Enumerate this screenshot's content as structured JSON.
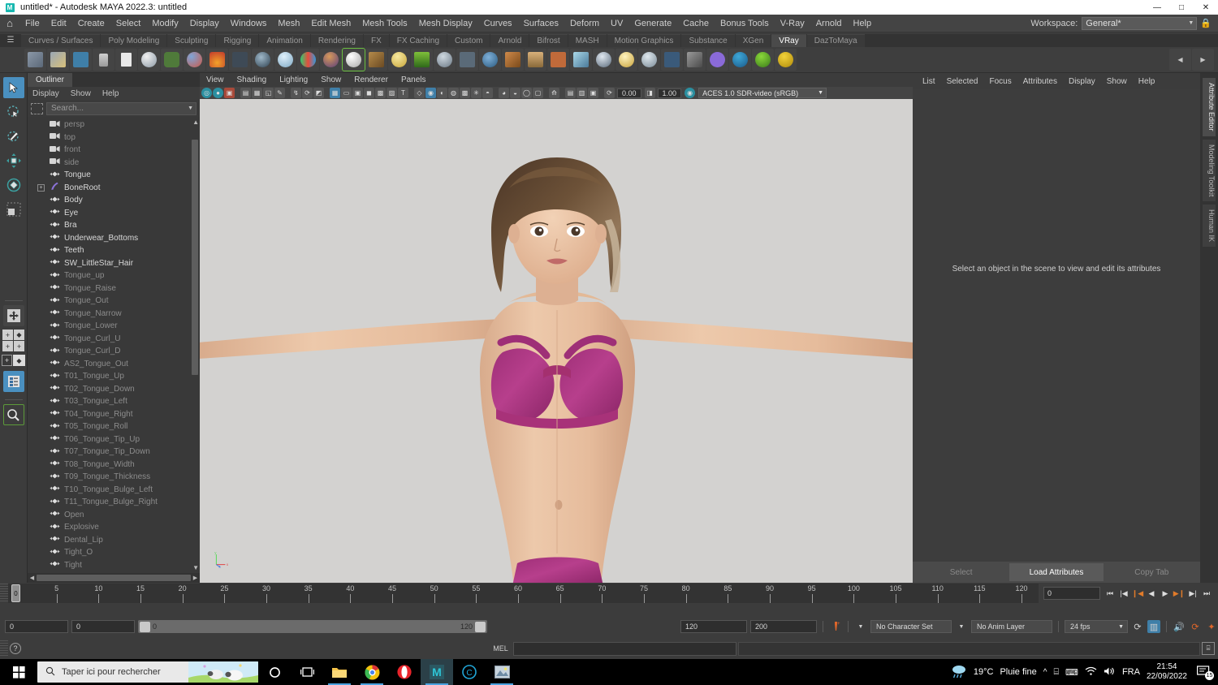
{
  "window": {
    "title": "untitled* - Autodesk MAYA 2022.3: untitled",
    "app_badge": "M",
    "minimize": "—",
    "maximize": "□",
    "close": "✕"
  },
  "main_menu": {
    "home_icon": "⌂",
    "items": [
      "File",
      "Edit",
      "Create",
      "Select",
      "Modify",
      "Display",
      "Windows",
      "Mesh",
      "Edit Mesh",
      "Mesh Tools",
      "Mesh Display",
      "Curves",
      "Surfaces",
      "Deform",
      "UV",
      "Generate",
      "Cache",
      "Bonus Tools",
      "V-Ray",
      "Arnold",
      "Help"
    ],
    "workspace_label": "Workspace:",
    "workspace_value": "General*",
    "lock_icon": "🔒"
  },
  "shelf": {
    "menu_icon": "☰",
    "tabs": [
      "Curves / Surfaces",
      "Poly Modeling",
      "Sculpting",
      "Rigging",
      "Animation",
      "Rendering",
      "FX",
      "FX Caching",
      "Custom",
      "Arnold",
      "Bifrost",
      "MASH",
      "Motion Graphics",
      "Substance",
      "XGen",
      "VRay",
      "DazToMaya"
    ],
    "active_tab": "VRay"
  },
  "tools": {
    "items": [
      {
        "name": "select-tool",
        "glyph": "⬉",
        "active": true
      },
      {
        "name": "lasso-select-tool",
        "glyph": "◌"
      },
      {
        "name": "paint-select-tool",
        "glyph": "✎"
      },
      {
        "name": "move-tool",
        "glyph": "✥"
      },
      {
        "name": "rotate-tool",
        "glyph": "◈"
      },
      {
        "name": "scale-tool",
        "glyph": "◰"
      }
    ],
    "lower": [
      {
        "name": "universal-manip-tool",
        "glyph": "✥"
      },
      {
        "name": "snap-grid-toggle",
        "glyph": "⊞"
      },
      {
        "name": "snap-curve-toggle",
        "glyph": "⊞"
      },
      {
        "name": "show-manip-tool",
        "glyph": "◫"
      },
      {
        "name": "outliner-toggle",
        "glyph": "▤",
        "active": true
      },
      {
        "name": "magnify-tool",
        "glyph": "🔍"
      }
    ]
  },
  "outliner": {
    "tab_label": "Outliner",
    "menu": [
      "Display",
      "Show",
      "Help"
    ],
    "search_placeholder": "Search...",
    "items": [
      {
        "label": "persp",
        "icon": "camera",
        "dim": true,
        "indent": 0
      },
      {
        "label": "top",
        "icon": "camera",
        "dim": true,
        "indent": 0
      },
      {
        "label": "front",
        "icon": "camera",
        "dim": true,
        "indent": 0
      },
      {
        "label": "side",
        "icon": "camera",
        "dim": true,
        "indent": 0
      },
      {
        "label": "Tongue",
        "icon": "mesh",
        "dim": false,
        "indent": 0
      },
      {
        "label": "BoneRoot",
        "icon": "bone",
        "dim": false,
        "indent": 0,
        "expandable": true
      },
      {
        "label": "Body",
        "icon": "mesh",
        "dim": false,
        "indent": 0
      },
      {
        "label": "Eye",
        "icon": "mesh",
        "dim": false,
        "indent": 0
      },
      {
        "label": "Bra",
        "icon": "mesh",
        "dim": false,
        "indent": 0
      },
      {
        "label": "Underwear_Bottoms",
        "icon": "mesh",
        "dim": false,
        "indent": 0
      },
      {
        "label": "Teeth",
        "icon": "mesh",
        "dim": false,
        "indent": 0
      },
      {
        "label": "SW_LittleStar_Hair",
        "icon": "mesh",
        "dim": false,
        "indent": 0
      },
      {
        "label": "Tongue_up",
        "icon": "mesh",
        "dim": true,
        "indent": 0
      },
      {
        "label": "Tongue_Raise",
        "icon": "mesh",
        "dim": true,
        "indent": 0
      },
      {
        "label": "Tongue_Out",
        "icon": "mesh",
        "dim": true,
        "indent": 0
      },
      {
        "label": "Tongue_Narrow",
        "icon": "mesh",
        "dim": true,
        "indent": 0
      },
      {
        "label": "Tongue_Lower",
        "icon": "mesh",
        "dim": true,
        "indent": 0
      },
      {
        "label": "Tongue_Curl_U",
        "icon": "mesh",
        "dim": true,
        "indent": 0
      },
      {
        "label": "Tongue_Curl_D",
        "icon": "mesh",
        "dim": true,
        "indent": 0
      },
      {
        "label": "AS2_Tongue_Out",
        "icon": "mesh",
        "dim": true,
        "indent": 0
      },
      {
        "label": "T01_Tongue_Up",
        "icon": "mesh",
        "dim": true,
        "indent": 0
      },
      {
        "label": "T02_Tongue_Down",
        "icon": "mesh",
        "dim": true,
        "indent": 0
      },
      {
        "label": "T03_Tongue_Left",
        "icon": "mesh",
        "dim": true,
        "indent": 0
      },
      {
        "label": "T04_Tongue_Right",
        "icon": "mesh",
        "dim": true,
        "indent": 0
      },
      {
        "label": "T05_Tongue_Roll",
        "icon": "mesh",
        "dim": true,
        "indent": 0
      },
      {
        "label": "T06_Tongue_Tip_Up",
        "icon": "mesh",
        "dim": true,
        "indent": 0
      },
      {
        "label": "T07_Tongue_Tip_Down",
        "icon": "mesh",
        "dim": true,
        "indent": 0
      },
      {
        "label": "T08_Tongue_Width",
        "icon": "mesh",
        "dim": true,
        "indent": 0
      },
      {
        "label": "T09_Tongue_Thickness",
        "icon": "mesh",
        "dim": true,
        "indent": 0
      },
      {
        "label": "T10_Tongue_Bulge_Left",
        "icon": "mesh",
        "dim": true,
        "indent": 0
      },
      {
        "label": "T11_Tongue_Bulge_Right",
        "icon": "mesh",
        "dim": true,
        "indent": 0
      },
      {
        "label": "Open",
        "icon": "mesh",
        "dim": true,
        "indent": 0
      },
      {
        "label": "Explosive",
        "icon": "mesh",
        "dim": true,
        "indent": 0
      },
      {
        "label": "Dental_Lip",
        "icon": "mesh",
        "dim": true,
        "indent": 0
      },
      {
        "label": "Tight_O",
        "icon": "mesh",
        "dim": true,
        "indent": 0
      },
      {
        "label": "Tight",
        "icon": "mesh",
        "dim": true,
        "indent": 0
      }
    ]
  },
  "viewport": {
    "menu": [
      "View",
      "Shading",
      "Lighting",
      "Show",
      "Renderer",
      "Panels"
    ],
    "exposure_value": "0.00",
    "gamma_value": "1.00",
    "colorspace": "ACES 1.0 SDR-video (sRGB)",
    "axis_labels": {
      "x": "x",
      "y": "y",
      "z": "z"
    },
    "background_color": "#d3d2d0"
  },
  "attribute_editor": {
    "menu": [
      "List",
      "Selected",
      "Focus",
      "Attributes",
      "Display",
      "Show",
      "Help"
    ],
    "hint": "Select an object in the scene to view and edit its attributes",
    "buttons": {
      "select": "Select",
      "load": "Load Attributes",
      "copy": "Copy Tab"
    },
    "side_tabs": [
      "Attribute Editor",
      "Modeling Toolkit",
      "Human IK"
    ],
    "active_side_tab": "Attribute Editor"
  },
  "timeline": {
    "ticks": [
      0,
      5,
      10,
      15,
      20,
      25,
      30,
      35,
      40,
      45,
      50,
      55,
      60,
      65,
      70,
      75,
      80,
      85,
      90,
      95,
      100,
      105,
      110,
      115,
      120
    ],
    "current_frame": "0",
    "current_field": "0",
    "playback_buttons": [
      "⏮",
      "⏪",
      "◀|",
      "◀",
      "▶",
      "|▶",
      "⏩",
      "⏭"
    ]
  },
  "range": {
    "start_field": "0",
    "end_field": "0",
    "bar_min": "0",
    "bar_max": "120",
    "playback_start": "120",
    "playback_end": "200",
    "auto_key_icon": "key-plus-icon",
    "character_set": "No Character Set",
    "anim_layer": "No Anim Layer",
    "fps": "24 fps",
    "loop_icon": "⟳",
    "prefs_icon": "▥",
    "sound_icon": "🔊",
    "anim_prefs_icon": "⟳",
    "run_icon": "🏃"
  },
  "command_line": {
    "help_icon": "?",
    "mel_label": "MEL",
    "input_value": "",
    "result_value": "",
    "script_editor_icon": "script-editor-icon"
  },
  "taskbar": {
    "start_icon": "⊞",
    "search_placeholder": "Taper ici pour rechercher",
    "search_icon": "🔍",
    "apps": [
      {
        "name": "cortana-icon",
        "glyph": "○"
      },
      {
        "name": "task-view-icon",
        "glyph": "❐"
      },
      {
        "name": "file-explorer-icon",
        "glyph": "🗀"
      },
      {
        "name": "chrome-icon",
        "glyph": "◉"
      },
      {
        "name": "opera-icon",
        "glyph": "O"
      },
      {
        "name": "maya-icon",
        "glyph": "M"
      },
      {
        "name": "clip-studio-icon",
        "glyph": "C"
      },
      {
        "name": "image-viewer-icon",
        "glyph": "▤"
      }
    ],
    "weather_temp": "19°C",
    "weather_text": "Pluie fine",
    "tray_icons": [
      "^",
      "⌸",
      "⌨",
      "📶",
      "🔊"
    ],
    "language": "FRA",
    "time": "21:54",
    "date": "22/09/2022",
    "notification_count": "15"
  }
}
